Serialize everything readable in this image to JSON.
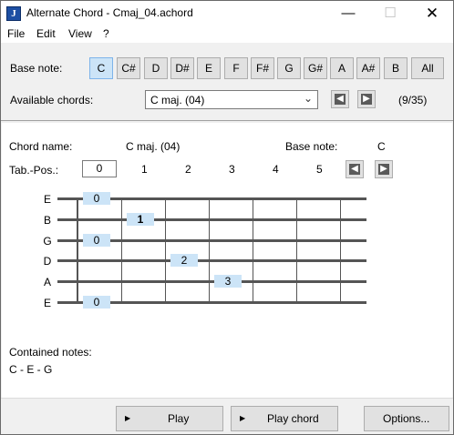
{
  "window": {
    "title": "Alternate Chord - Cmaj_04.achord",
    "app_icon_glyph": "J",
    "controls": {
      "minimize": "—",
      "maximize": "☐",
      "close": "✕"
    }
  },
  "menu": [
    "File",
    "Edit",
    "View",
    "?"
  ],
  "base_note": {
    "label": "Base note:",
    "notes": [
      "C",
      "C#",
      "D",
      "D#",
      "E",
      "F",
      "F#",
      "G",
      "G#",
      "A",
      "A#",
      "B",
      "All"
    ],
    "selected": "C"
  },
  "available_chords": {
    "label": "Available chords:",
    "value": "C maj. (04)",
    "counter": "(9/35)"
  },
  "chord_info": {
    "name_label": "Chord name:",
    "name_value": "C maj. (04)",
    "base_label": "Base note:",
    "base_value": "C"
  },
  "tab_position": {
    "label": "Tab.-Pos.:",
    "current": "0",
    "numbers": [
      "1",
      "2",
      "3",
      "4",
      "5"
    ]
  },
  "fretboard": {
    "strings": [
      "E",
      "B",
      "G",
      "D",
      "A",
      "E"
    ],
    "fingers": [
      {
        "string": 0,
        "fret": 0,
        "text": "0"
      },
      {
        "string": 1,
        "fret": 1,
        "text": "1"
      },
      {
        "string": 2,
        "fret": 0,
        "text": "0"
      },
      {
        "string": 3,
        "fret": 2,
        "text": "2"
      },
      {
        "string": 4,
        "fret": 3,
        "text": "3"
      },
      {
        "string": 5,
        "fret": 0,
        "text": "0"
      }
    ]
  },
  "contained_notes": {
    "label": "Contained notes:",
    "value": "C - E - G"
  },
  "buttons": {
    "play": "Play",
    "play_chord": "Play chord",
    "options": "Options..."
  },
  "icons": {
    "prev": "arrow-left-icon",
    "next": "arrow-right-icon",
    "dropdown": "chevron-down-icon"
  }
}
